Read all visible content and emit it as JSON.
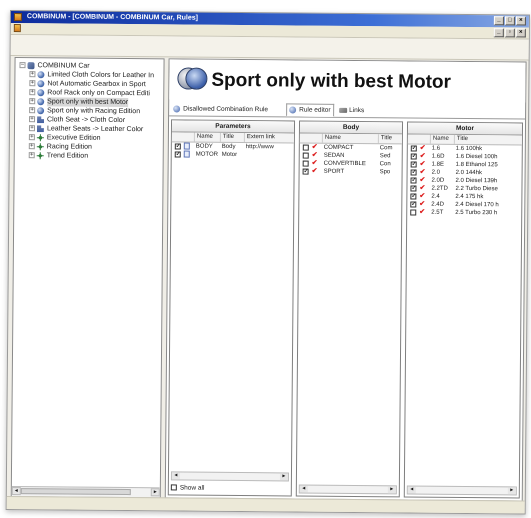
{
  "window": {
    "title": "COMBINUM - [COMBINUM - COMBINUM Car, Rules]",
    "controls": [
      "_",
      "□",
      "×"
    ],
    "mdi_controls": [
      "_",
      "▫",
      "×"
    ]
  },
  "tree": {
    "items": [
      {
        "label": "COMBINUM Car",
        "icon": "root-icon",
        "level": 0,
        "expander": "−"
      },
      {
        "label": "Limited Cloth Colors for Leather In",
        "icon": "rule-icon",
        "level": 1,
        "expander": "+"
      },
      {
        "label": "Not Automatic Gearbox in Sport",
        "icon": "rule-icon",
        "level": 1,
        "expander": "+"
      },
      {
        "label": "Roof Rack only on Compact Editi",
        "icon": "rule-icon",
        "level": 1,
        "expander": "+"
      },
      {
        "label": "Sport only with best Motor",
        "icon": "rule-icon",
        "level": 1,
        "expander": "+",
        "selected": true
      },
      {
        "label": "Sport only with Racing Edition",
        "icon": "rule-icon",
        "level": 1,
        "expander": "+"
      },
      {
        "label": "Cloth Seat -> Cloth Color",
        "icon": "cloth-icon",
        "level": 1,
        "expander": "+"
      },
      {
        "label": "Leather Seats -> Leather Color",
        "icon": "cloth-icon",
        "level": 1,
        "expander": "+"
      },
      {
        "label": "Executive Edition",
        "icon": "edition-icon",
        "level": 1,
        "expander": "+"
      },
      {
        "label": "Racing Edition",
        "icon": "edition-icon",
        "level": 1,
        "expander": "+"
      },
      {
        "label": "Trend Edition",
        "icon": "edition-icon",
        "level": 1,
        "expander": "+"
      }
    ]
  },
  "header": {
    "title": "Sport only with best Motor"
  },
  "tabs": [
    {
      "label": "Disallowed Combination Rule",
      "icon": "rule-icon",
      "active": false
    },
    {
      "label": "Rule editor",
      "icon": "rule-icon",
      "active": true
    },
    {
      "label": "Links",
      "icon": "link-icon",
      "active": false
    }
  ],
  "parameters": {
    "heading": "Parameters",
    "columns": [
      "Name",
      "Title",
      "Extern link"
    ],
    "rows": [
      {
        "checked": true,
        "name": "BODY",
        "title": "Body",
        "link": "http://www"
      },
      {
        "checked": true,
        "name": "MOTOR",
        "title": "Motor",
        "link": ""
      }
    ],
    "show_all_label": "Show all"
  },
  "body": {
    "heading": "Body",
    "columns": [
      "Name",
      "Title"
    ],
    "rows": [
      {
        "checked": false,
        "name": "COMPACT",
        "title": "Com"
      },
      {
        "checked": false,
        "name": "SEDAN",
        "title": "Sed"
      },
      {
        "checked": false,
        "name": "CONVERTIBLE",
        "title": "Con"
      },
      {
        "checked": true,
        "name": "SPORT",
        "title": "Spo"
      }
    ]
  },
  "motor": {
    "heading": "Motor",
    "columns": [
      "Name",
      "Title"
    ],
    "rows": [
      {
        "checked": true,
        "name": "1.6",
        "title": "1.6 100hk"
      },
      {
        "checked": true,
        "name": "1.6D",
        "title": "1.6 Diesel 100h"
      },
      {
        "checked": true,
        "name": "1.8E",
        "title": "1.8 Ethanol 125"
      },
      {
        "checked": true,
        "name": "2.0",
        "title": "2.0 144hk"
      },
      {
        "checked": true,
        "name": "2.0D",
        "title": "2.0 Diesel 139h"
      },
      {
        "checked": true,
        "name": "2.2TD",
        "title": "2.2 Turbo Diese"
      },
      {
        "checked": true,
        "name": "2.4",
        "title": "2.4 175 hk"
      },
      {
        "checked": true,
        "name": "2.4D",
        "title": "2.4 Diesel 170 h"
      },
      {
        "checked": false,
        "name": "2.5T",
        "title": "2.5 Turbo 230 h"
      }
    ]
  },
  "colors": {
    "titlebar_start": "#0c2b9c",
    "titlebar_end": "#8aa9e3",
    "check_mark": "#d22222"
  }
}
